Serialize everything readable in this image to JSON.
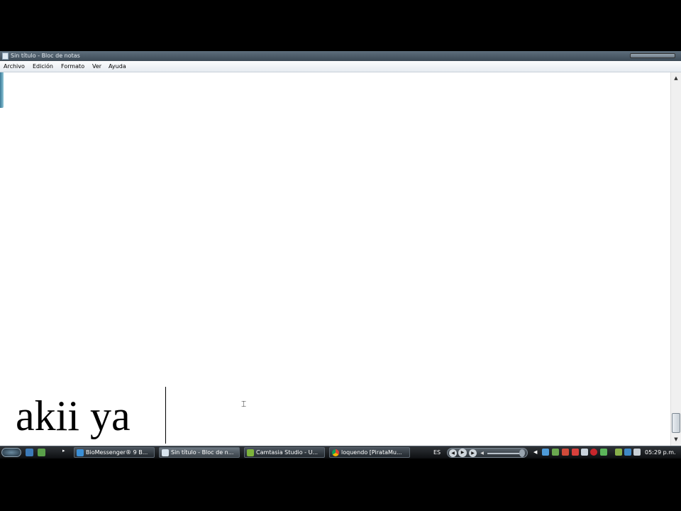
{
  "window": {
    "title": "Sin título - Bloc de notas"
  },
  "menubar": {
    "items": [
      "Archivo",
      "Edición",
      "Formato",
      "Ver",
      "Ayuda"
    ]
  },
  "editor": {
    "text": "akii ya"
  },
  "taskbar": {
    "tasks": [
      {
        "label": "BioMessenger® 9 B...",
        "icon": "messenger-icon"
      },
      {
        "label": "Sin título - Bloc de n...",
        "icon": "notepad-icon"
      },
      {
        "label": "Camtasia Studio - U...",
        "icon": "camtasia-icon"
      },
      {
        "label": "loquendo [PirataMu...",
        "icon": "chrome-icon"
      }
    ],
    "language": "ES",
    "clock": "05:29 p.m."
  },
  "colors": {
    "titlebar": "#4a5866",
    "taskbar": "#1b1f23",
    "editor_bg": "#ffffff"
  }
}
